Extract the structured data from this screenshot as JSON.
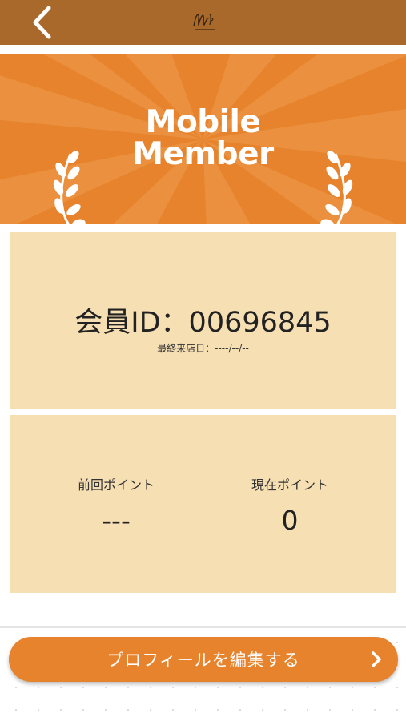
{
  "header": {
    "back_icon": "chevron-left-icon",
    "logo_icon": "brand-logo-icon"
  },
  "banner": {
    "line1": "Mobile",
    "line2": "Member",
    "laurel_icon": "laurel-icon",
    "color": "#e6832c"
  },
  "member": {
    "id_text": "会員ID：00696845",
    "last_visit": "最終来店日：----/--/--"
  },
  "points": {
    "previous_label": "前回ポイント",
    "previous_value": "---",
    "current_label": "現在ポイント",
    "current_value": "0"
  },
  "actions": {
    "edit_profile_label": "プロフィールを編集する",
    "chevron_icon": "chevron-right-icon"
  },
  "colors": {
    "header_bar": "#a8692a",
    "accent": "#e6832c",
    "panel": "#f7dfb4"
  }
}
